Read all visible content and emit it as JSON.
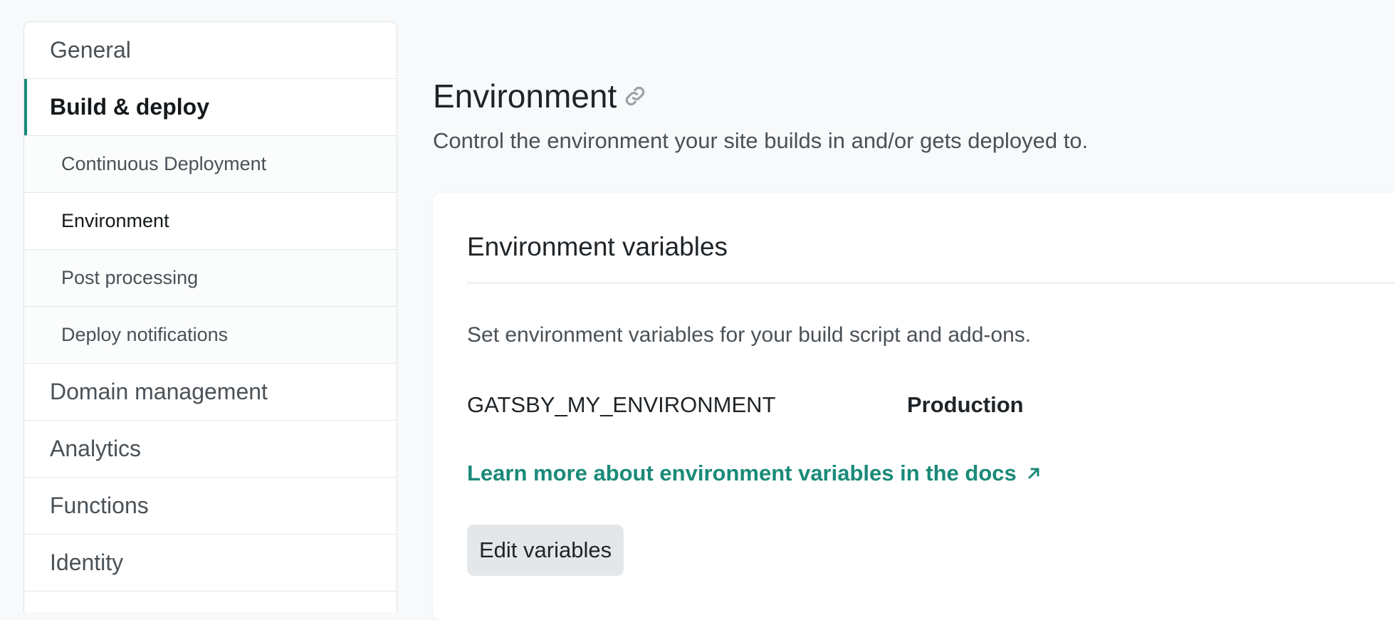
{
  "sidebar": {
    "items": [
      {
        "label": "General"
      },
      {
        "label": "Build & deploy"
      },
      {
        "label": "Continuous Deployment"
      },
      {
        "label": "Environment"
      },
      {
        "label": "Post processing"
      },
      {
        "label": "Deploy notifications"
      },
      {
        "label": "Domain management"
      },
      {
        "label": "Analytics"
      },
      {
        "label": "Functions"
      },
      {
        "label": "Identity"
      }
    ],
    "accent_color": "#1a8a79"
  },
  "main": {
    "title": "Environment",
    "description": "Control the environment your site builds in and/or gets deployed to.",
    "card": {
      "title": "Environment variables",
      "description": "Set environment variables for your build script and add-ons.",
      "variables": [
        {
          "key": "GATSBY_MY_ENVIRONMENT",
          "value": "Production"
        }
      ],
      "docs_link": "Learn more about environment variables in the docs",
      "edit_button": "Edit variables"
    }
  },
  "icons": {
    "title_link": "link-icon",
    "docs_external": "arrow-up-right-icon"
  }
}
